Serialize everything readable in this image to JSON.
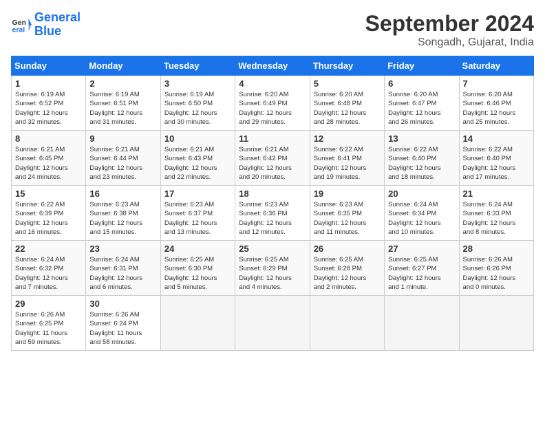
{
  "logo": {
    "line1": "General",
    "line2": "Blue"
  },
  "title": "September 2024",
  "location": "Songadh, Gujarat, India",
  "headers": [
    "Sunday",
    "Monday",
    "Tuesday",
    "Wednesday",
    "Thursday",
    "Friday",
    "Saturday"
  ],
  "weeks": [
    [
      {
        "day": "1",
        "info": "Sunrise: 6:19 AM\nSunset: 6:52 PM\nDaylight: 12 hours\nand 32 minutes."
      },
      {
        "day": "2",
        "info": "Sunrise: 6:19 AM\nSunset: 6:51 PM\nDaylight: 12 hours\nand 31 minutes."
      },
      {
        "day": "3",
        "info": "Sunrise: 6:19 AM\nSunset: 6:50 PM\nDaylight: 12 hours\nand 30 minutes."
      },
      {
        "day": "4",
        "info": "Sunrise: 6:20 AM\nSunset: 6:49 PM\nDaylight: 12 hours\nand 29 minutes."
      },
      {
        "day": "5",
        "info": "Sunrise: 6:20 AM\nSunset: 6:48 PM\nDaylight: 12 hours\nand 28 minutes."
      },
      {
        "day": "6",
        "info": "Sunrise: 6:20 AM\nSunset: 6:47 PM\nDaylight: 12 hours\nand 26 minutes."
      },
      {
        "day": "7",
        "info": "Sunrise: 6:20 AM\nSunset: 6:46 PM\nDaylight: 12 hours\nand 25 minutes."
      }
    ],
    [
      {
        "day": "8",
        "info": "Sunrise: 6:21 AM\nSunset: 6:45 PM\nDaylight: 12 hours\nand 24 minutes."
      },
      {
        "day": "9",
        "info": "Sunrise: 6:21 AM\nSunset: 6:44 PM\nDaylight: 12 hours\nand 23 minutes."
      },
      {
        "day": "10",
        "info": "Sunrise: 6:21 AM\nSunset: 6:43 PM\nDaylight: 12 hours\nand 22 minutes."
      },
      {
        "day": "11",
        "info": "Sunrise: 6:21 AM\nSunset: 6:42 PM\nDaylight: 12 hours\nand 20 minutes."
      },
      {
        "day": "12",
        "info": "Sunrise: 6:22 AM\nSunset: 6:41 PM\nDaylight: 12 hours\nand 19 minutes."
      },
      {
        "day": "13",
        "info": "Sunrise: 6:22 AM\nSunset: 6:40 PM\nDaylight: 12 hours\nand 18 minutes."
      },
      {
        "day": "14",
        "info": "Sunrise: 6:22 AM\nSunset: 6:40 PM\nDaylight: 12 hours\nand 17 minutes."
      }
    ],
    [
      {
        "day": "15",
        "info": "Sunrise: 6:22 AM\nSunset: 6:39 PM\nDaylight: 12 hours\nand 16 minutes."
      },
      {
        "day": "16",
        "info": "Sunrise: 6:23 AM\nSunset: 6:38 PM\nDaylight: 12 hours\nand 15 minutes."
      },
      {
        "day": "17",
        "info": "Sunrise: 6:23 AM\nSunset: 6:37 PM\nDaylight: 12 hours\nand 13 minutes."
      },
      {
        "day": "18",
        "info": "Sunrise: 6:23 AM\nSunset: 6:36 PM\nDaylight: 12 hours\nand 12 minutes."
      },
      {
        "day": "19",
        "info": "Sunrise: 6:23 AM\nSunset: 6:35 PM\nDaylight: 12 hours\nand 11 minutes."
      },
      {
        "day": "20",
        "info": "Sunrise: 6:24 AM\nSunset: 6:34 PM\nDaylight: 12 hours\nand 10 minutes."
      },
      {
        "day": "21",
        "info": "Sunrise: 6:24 AM\nSunset: 6:33 PM\nDaylight: 12 hours\nand 8 minutes."
      }
    ],
    [
      {
        "day": "22",
        "info": "Sunrise: 6:24 AM\nSunset: 6:32 PM\nDaylight: 12 hours\nand 7 minutes."
      },
      {
        "day": "23",
        "info": "Sunrise: 6:24 AM\nSunset: 6:31 PM\nDaylight: 12 hours\nand 6 minutes."
      },
      {
        "day": "24",
        "info": "Sunrise: 6:25 AM\nSunset: 6:30 PM\nDaylight: 12 hours\nand 5 minutes."
      },
      {
        "day": "25",
        "info": "Sunrise: 6:25 AM\nSunset: 6:29 PM\nDaylight: 12 hours\nand 4 minutes."
      },
      {
        "day": "26",
        "info": "Sunrise: 6:25 AM\nSunset: 6:28 PM\nDaylight: 12 hours\nand 2 minutes."
      },
      {
        "day": "27",
        "info": "Sunrise: 6:25 AM\nSunset: 6:27 PM\nDaylight: 12 hours\nand 1 minute."
      },
      {
        "day": "28",
        "info": "Sunrise: 6:26 AM\nSunset: 6:26 PM\nDaylight: 12 hours\nand 0 minutes."
      }
    ],
    [
      {
        "day": "29",
        "info": "Sunrise: 6:26 AM\nSunset: 6:25 PM\nDaylight: 11 hours\nand 59 minutes."
      },
      {
        "day": "30",
        "info": "Sunrise: 6:26 AM\nSunset: 6:24 PM\nDaylight: 11 hours\nand 58 minutes."
      },
      null,
      null,
      null,
      null,
      null
    ]
  ]
}
